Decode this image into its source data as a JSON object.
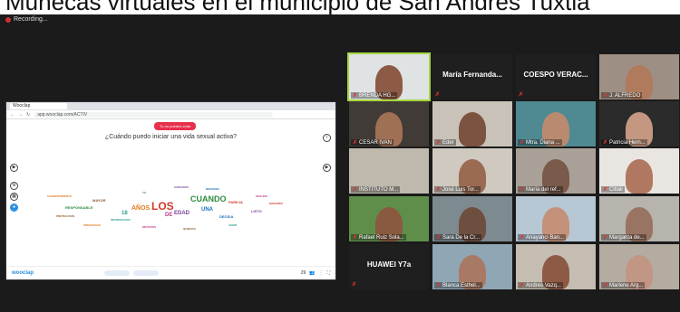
{
  "caption": "Muñecas virtuales en el municipio de San Andrés Tuxtla",
  "recording": "Recording...",
  "shared_screen": {
    "tab_title": "Wooclap",
    "address": "app.wooclap.com/ACTIV",
    "pill": "Tu no puedes votar",
    "question": "¿Cuándo puedo iniciar una vida sexual activa?",
    "brand": "wooclap",
    "counter": "29",
    "words": [
      {
        "t": "LOS",
        "c": "#d1392b",
        "s": 12
      },
      {
        "t": "CUANDO",
        "c": "#2e8b3d",
        "s": 9
      },
      {
        "t": "AÑOS",
        "c": "#e07b1a",
        "s": 7
      },
      {
        "t": "EDAD",
        "c": "#7a3fa0",
        "s": 6
      },
      {
        "t": "UNA",
        "c": "#1c6fb8",
        "s": 6
      },
      {
        "t": "DE",
        "c": "#c23b8a",
        "s": 6
      },
      {
        "t": "18",
        "c": "#2a9d8f",
        "s": 6
      },
      {
        "t": "MAYOR",
        "c": "#8a5a2b",
        "s": 4
      },
      {
        "t": "PAREJA",
        "c": "#d1392b",
        "s": 4
      },
      {
        "t": "RESPONSABLE",
        "c": "#2e8b3d",
        "s": 4
      },
      {
        "t": "DECIDA",
        "c": "#1c6fb8",
        "s": 4
      },
      {
        "t": "LISTO",
        "c": "#7a3fa0",
        "s": 4
      },
      {
        "t": "CONSENTIMIENTO",
        "c": "#e07b1a",
        "s": 3
      },
      {
        "t": "INFORMACION",
        "c": "#2a9d8f",
        "s": 3
      },
      {
        "t": "SEGURO",
        "c": "#c23b8a",
        "s": 3
      },
      {
        "t": "PROTECCION",
        "c": "#8a5a2b",
        "s": 3
      },
      {
        "t": "MADUREZ",
        "c": "#d1392b",
        "s": 3
      },
      {
        "t": "TU",
        "c": "#2e8b3d",
        "s": 3
      },
      {
        "t": "DECISION",
        "c": "#1c6fb8",
        "s": 3
      },
      {
        "t": "CUIDADOS",
        "c": "#7a3fa0",
        "s": 3
      },
      {
        "t": "PREPARADO",
        "c": "#e07b1a",
        "s": 3
      },
      {
        "t": "AMOR",
        "c": "#2a9d8f",
        "s": 3
      },
      {
        "t": "METODOS",
        "c": "#c23b8a",
        "s": 3
      },
      {
        "t": "QUIERAS",
        "c": "#8a5a2b",
        "s": 3
      }
    ]
  },
  "participants": [
    {
      "name": "BRENDA HG...",
      "cam": true,
      "active": true,
      "bg": "#dfe3e4",
      "skin": "#8d5a45"
    },
    {
      "name": "María Fernanda...",
      "cam": false
    },
    {
      "name": "COESPO VERAC...",
      "cam": false
    },
    {
      "name": "J. ALFREDO",
      "cam": true,
      "bg": "#9e8f84",
      "skin": "#b07a5c"
    },
    {
      "name": "CESAR IVAN",
      "cam": true,
      "bg": "#403b36",
      "skin": "#a07055"
    },
    {
      "name": "Eder",
      "cam": true,
      "bg": "#c9c2b8",
      "skin": "#7c5240"
    },
    {
      "name": "Mtra. Diana ...",
      "cam": true,
      "bg": "#4f8a93",
      "skin": "#b98a70"
    },
    {
      "name": "Patricia Hern...",
      "cam": true,
      "bg": "#2b2b2b",
      "skin": "#c49880"
    },
    {
      "name": "INSTITUTO M...",
      "cam": true,
      "bg": "#bfb8ad",
      "skin": "#bfb8ad"
    },
    {
      "name": "José Luis Tor...",
      "cam": true,
      "bg": "#cfc9c0",
      "skin": "#9a6a52"
    },
    {
      "name": "María del ref...",
      "cam": true,
      "bg": "#a9a197",
      "skin": "#7a5a4a"
    },
    {
      "name": "Citlali",
      "cam": true,
      "bg": "#e9e6e1",
      "skin": "#b07860"
    },
    {
      "name": "Rafael Ruiz Sola...",
      "cam": true,
      "bg": "#5f8e4a",
      "skin": "#8a5a40"
    },
    {
      "name": "Sara De la Cr...",
      "cam": true,
      "bg": "#7d8a8f",
      "skin": "#6e4f3f"
    },
    {
      "name": "Anayanci Ban...",
      "cam": true,
      "bg": "#b7c7d4",
      "skin": "#c4917a"
    },
    {
      "name": "Margarita de...",
      "cam": true,
      "bg": "#b6b4ac",
      "skin": "#9a7462"
    },
    {
      "name": "HUAWEI Y7a",
      "cam": false
    },
    {
      "name": "Blanca Esthel...",
      "cam": true,
      "bg": "#8fa6b5",
      "skin": "#a87a65"
    },
    {
      "name": "Andres Vazq...",
      "cam": true,
      "bg": "#c5bdb2",
      "skin": "#8c5a45"
    },
    {
      "name": "Marlene Arg...",
      "cam": true,
      "bg": "#b4aca1",
      "skin": "#c29684"
    }
  ]
}
